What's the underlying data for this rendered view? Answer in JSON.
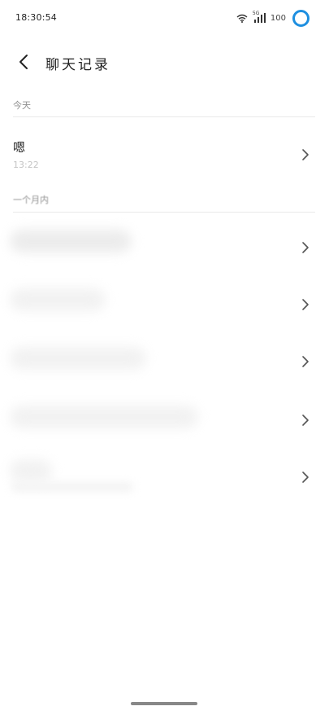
{
  "status_bar": {
    "time": "18:30:54",
    "network_type": "5G",
    "battery": "100"
  },
  "header": {
    "title": "聊天记录"
  },
  "sections": {
    "today_label": "今天",
    "month_label": "一个月内"
  },
  "today_items": [
    {
      "title": "嗯",
      "time": "13:22"
    }
  ],
  "month_items_count_note": "",
  "colors": {
    "accent": "#1e8fe0",
    "divider": "#e9e9e9",
    "secondary_text": "#8f8f8f"
  }
}
